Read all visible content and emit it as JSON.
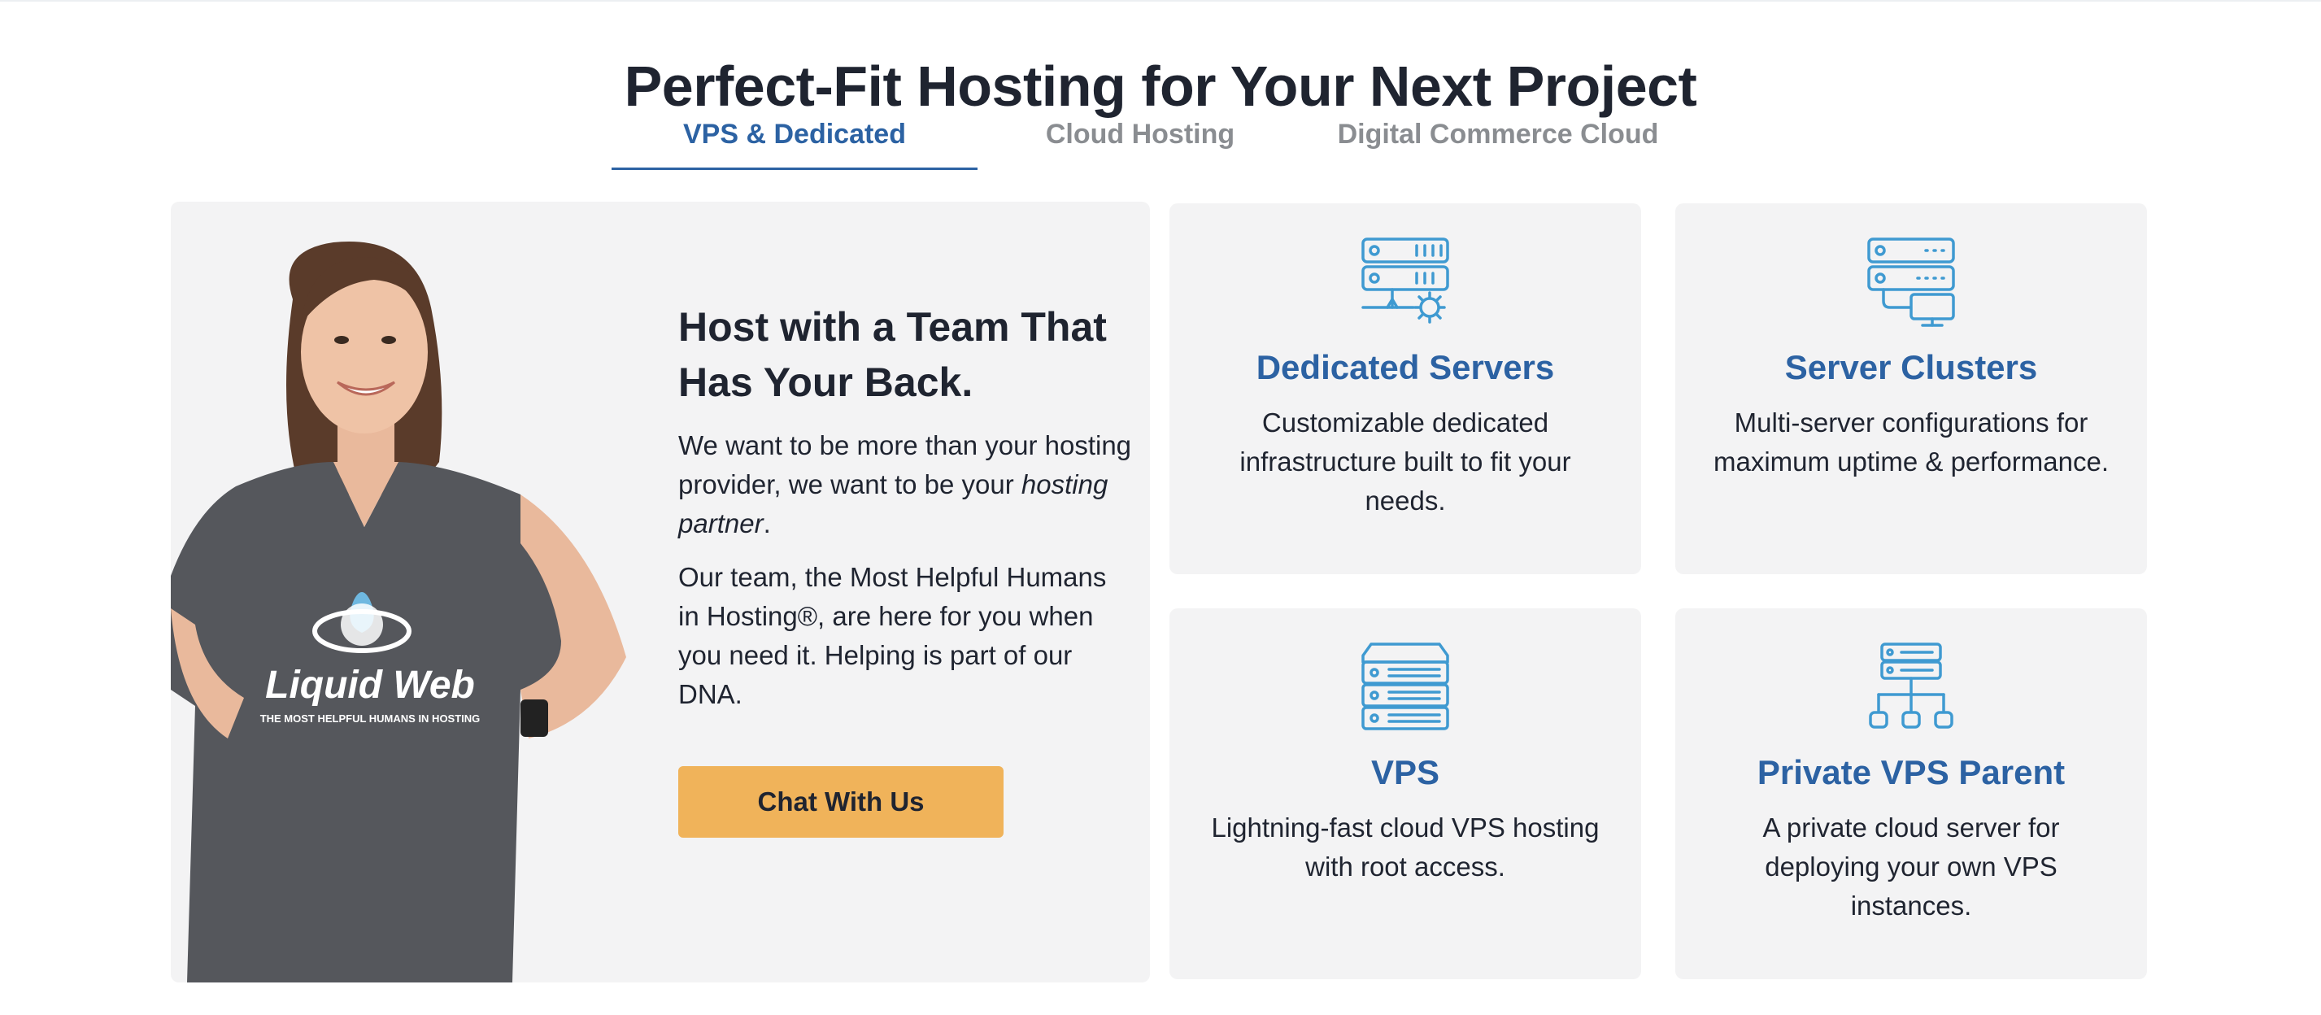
{
  "page_title": "Perfect-Fit Hosting for Your Next Project",
  "tabs": [
    {
      "label": "VPS & Dedicated",
      "active": true
    },
    {
      "label": "Cloud Hosting",
      "active": false
    },
    {
      "label": "Digital Commerce Cloud",
      "active": false
    }
  ],
  "promo": {
    "heading": "Host with a Team That Has Your Back.",
    "p1_before": "We want to be more than your hosting provider, we want to be your ",
    "p1_em": "hosting partner",
    "p1_after": ".",
    "p2": "Our team, the Most Helpful Humans in Hosting®, are here for you when you need it. Helping is part of our DNA.",
    "button_label": "Chat With Us",
    "shirt_brand": "Liquid Web",
    "shirt_tagline": "THE MOST HELPFUL HUMANS IN HOSTING"
  },
  "cards": [
    {
      "icon": "dedicated-server-gear-icon",
      "title": "Dedicated Servers",
      "desc": "Customizable dedicated infrastructure built to fit your needs."
    },
    {
      "icon": "server-cluster-icon",
      "title": "Server Clusters",
      "desc": "Multi-server configurations for maximum uptime & performance."
    },
    {
      "icon": "vps-stack-icon",
      "title": "VPS",
      "desc": "Lightning-fast cloud VPS hosting with root access."
    },
    {
      "icon": "network-tree-icon",
      "title": "Private VPS Parent",
      "desc": "A private cloud server for deploying your own VPS instances."
    }
  ],
  "colors": {
    "accent_blue": "#2c62a3",
    "icon_blue": "#3f9ad1",
    "button_orange": "#f0b35a",
    "card_bg": "#f3f3f4",
    "text_dark": "#1f2430",
    "tab_inactive": "#8a8d91"
  }
}
